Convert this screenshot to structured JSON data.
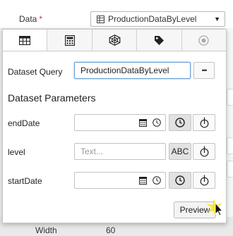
{
  "data_field": {
    "label": "Data",
    "required_mark": "*",
    "selected_value": "ProductionDataByLevel"
  },
  "tabs": [
    {
      "icon": "table-icon",
      "active": true
    },
    {
      "icon": "calculator-icon",
      "active": false
    },
    {
      "icon": "hexagon-network-icon",
      "active": false
    },
    {
      "icon": "tag-icon",
      "active": false
    },
    {
      "icon": "target-circle-icon",
      "active": false
    }
  ],
  "dataset_query": {
    "label": "Dataset Query",
    "value": "ProductionDataByLevel",
    "more_button": "•••"
  },
  "dataset_parameters": {
    "title": "Dataset Parameters",
    "params": [
      {
        "name": "endDate",
        "value": "",
        "type": "date"
      },
      {
        "name": "level",
        "value": "",
        "placeholder": "Text...",
        "type": "text",
        "type_button": "ABC"
      },
      {
        "name": "startDate",
        "value": "",
        "type": "date"
      }
    ]
  },
  "preview_button": "Preview",
  "background": {
    "width_label": "Width",
    "width_value": "60"
  },
  "colors": {
    "required": "#d23030",
    "focus_border": "#6aa1d8",
    "cursor_highlight": "#f5e51c"
  }
}
